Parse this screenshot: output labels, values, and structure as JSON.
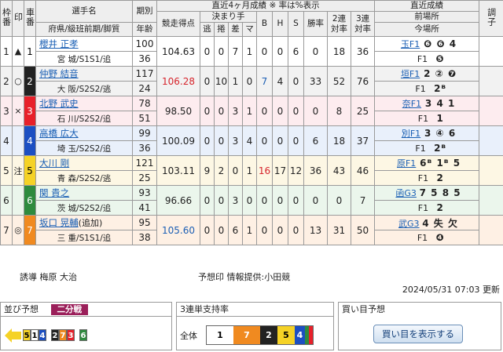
{
  "header": {
    "waku": "枠番",
    "mark": "印",
    "car": "車番",
    "name_l1": "選手名",
    "name_l2": "府県/級班前期/脚質",
    "term": "期別",
    "age": "年齢",
    "recent4": "直近4ヶ月成績 ※ 率は%表示",
    "score": "競走得点",
    "kimarite": "決まり手",
    "nige": "逃",
    "makuri": "捲",
    "sashi": "差",
    "ma": "マ",
    "b": "B",
    "h": "H",
    "s": "S",
    "win": "勝率",
    "ren2": "2連対率",
    "ren3": "3連対率",
    "latest": "直近成績",
    "prev_place": "前場所",
    "curr_place": "今場所",
    "adjust": "調子"
  },
  "riders": [
    {
      "waku": "1",
      "mark": "▲",
      "car": "1",
      "name": "櫻井 正孝",
      "pref": "宮 城/S1S1/追",
      "term": "100",
      "age": "36",
      "score": "104.63",
      "nige": "0",
      "makuri": "0",
      "sashi": "7",
      "ma": "1",
      "b": "0",
      "h": "0",
      "s": "6",
      "win": "0",
      "ren2": "18",
      "ren3": "36",
      "prev_place": "玉F1",
      "prev_res": "❻ ❻ 4",
      "curr_place": "F1",
      "curr_res": "❺"
    },
    {
      "waku": "2",
      "mark": "○",
      "car": "2",
      "name": "仲野 結音",
      "pref": "大 阪/S2S2/逃",
      "term": "117",
      "age": "24",
      "score": "106.28",
      "nige": "0",
      "makuri": "10",
      "sashi": "1",
      "ma": "0",
      "b": "7",
      "h": "4",
      "s": "0",
      "win": "33",
      "ren2": "52",
      "ren3": "76",
      "prev_place": "垣F1",
      "prev_res": "2 ② ❼",
      "curr_place": "F1",
      "curr_res": "2ᴮ"
    },
    {
      "waku": "3",
      "mark": "×",
      "car": "3",
      "name": "北野 武史",
      "pref": "石 川/S2S2/追",
      "term": "78",
      "age": "51",
      "score": "98.50",
      "nige": "0",
      "makuri": "0",
      "sashi": "3",
      "ma": "1",
      "b": "0",
      "h": "0",
      "s": "0",
      "win": "0",
      "ren2": "8",
      "ren3": "25",
      "prev_place": "奈F1",
      "prev_res": "3 4 1",
      "curr_place": "F1",
      "curr_res": "1"
    },
    {
      "waku": "4",
      "mark": "",
      "car": "4",
      "name": "高橋 広大",
      "pref": "埼 玉/S2S2/追",
      "term": "99",
      "age": "36",
      "score": "100.09",
      "nige": "0",
      "makuri": "0",
      "sashi": "3",
      "ma": "4",
      "b": "0",
      "h": "0",
      "s": "0",
      "win": "6",
      "ren2": "18",
      "ren3": "37",
      "prev_place": "別F1",
      "prev_res": "3 ④ 6",
      "curr_place": "F1",
      "curr_res": "2ᴮ"
    },
    {
      "waku": "5",
      "mark": "注",
      "car": "5",
      "name": "大川 剛",
      "pref": "青 森/S2S2/逃",
      "term": "121",
      "age": "25",
      "score": "103.11",
      "nige": "9",
      "makuri": "2",
      "sashi": "0",
      "ma": "1",
      "b": "16",
      "h": "17",
      "s": "12",
      "win": "36",
      "ren2": "43",
      "ren3": "46",
      "prev_place": "原F1",
      "prev_res": "6ᴮ 1ᴮ 5",
      "curr_place": "F1",
      "curr_res": "2"
    },
    {
      "waku": "6",
      "mark": "",
      "car": "6",
      "name": "関 貴之",
      "pref": "茨 城/S2S2/追",
      "term": "93",
      "age": "41",
      "score": "96.66",
      "nige": "0",
      "makuri": "0",
      "sashi": "3",
      "ma": "0",
      "b": "0",
      "h": "0",
      "s": "0",
      "win": "0",
      "ren2": "0",
      "ren3": "7",
      "prev_place": "函G3",
      "prev_res": "7 5 8 5",
      "curr_place": "F1",
      "curr_res": "2"
    },
    {
      "waku": "7",
      "mark": "◎",
      "car": "7",
      "name": "坂口 晃輔",
      "name_suffix": "(追加)",
      "pref": "三 重/S1S1/追",
      "term": "95",
      "age": "38",
      "score": "105.60",
      "nige": "0",
      "makuri": "0",
      "sashi": "6",
      "ma": "1",
      "b": "0",
      "h": "0",
      "s": "0",
      "win": "13",
      "ren2": "31",
      "ren3": "50",
      "prev_place": "武G3",
      "prev_res": "4 失 欠",
      "curr_place": "F1",
      "curr_res": "❹"
    }
  ],
  "footer": {
    "guide": "誘導 梅原 大治",
    "yoso": "予想印 情報提供:小田競",
    "updated": "2024/05/31 07:03 更新"
  },
  "line_box": {
    "title": "並び予想",
    "badge": "二分戦",
    "groups": [
      [
        "5",
        "1",
        "4"
      ],
      [
        "2",
        "7",
        "3"
      ],
      [
        "6"
      ]
    ]
  },
  "support_box": {
    "title": "3連単支持率",
    "label": "全体",
    "order": [
      "1",
      "7",
      "2",
      "5",
      "4",
      "6",
      "3"
    ]
  },
  "buy_box": {
    "title": "買い目予想",
    "button": "買い目を表示する"
  },
  "colors": {
    "accent": "#9b1f5a",
    "car1": "#ffffff",
    "car2": "#222222",
    "car3": "#e8202a",
    "car4": "#1c4fc2",
    "car5": "#f5d226",
    "car6": "#2e8b3e",
    "car7": "#f08a20"
  }
}
